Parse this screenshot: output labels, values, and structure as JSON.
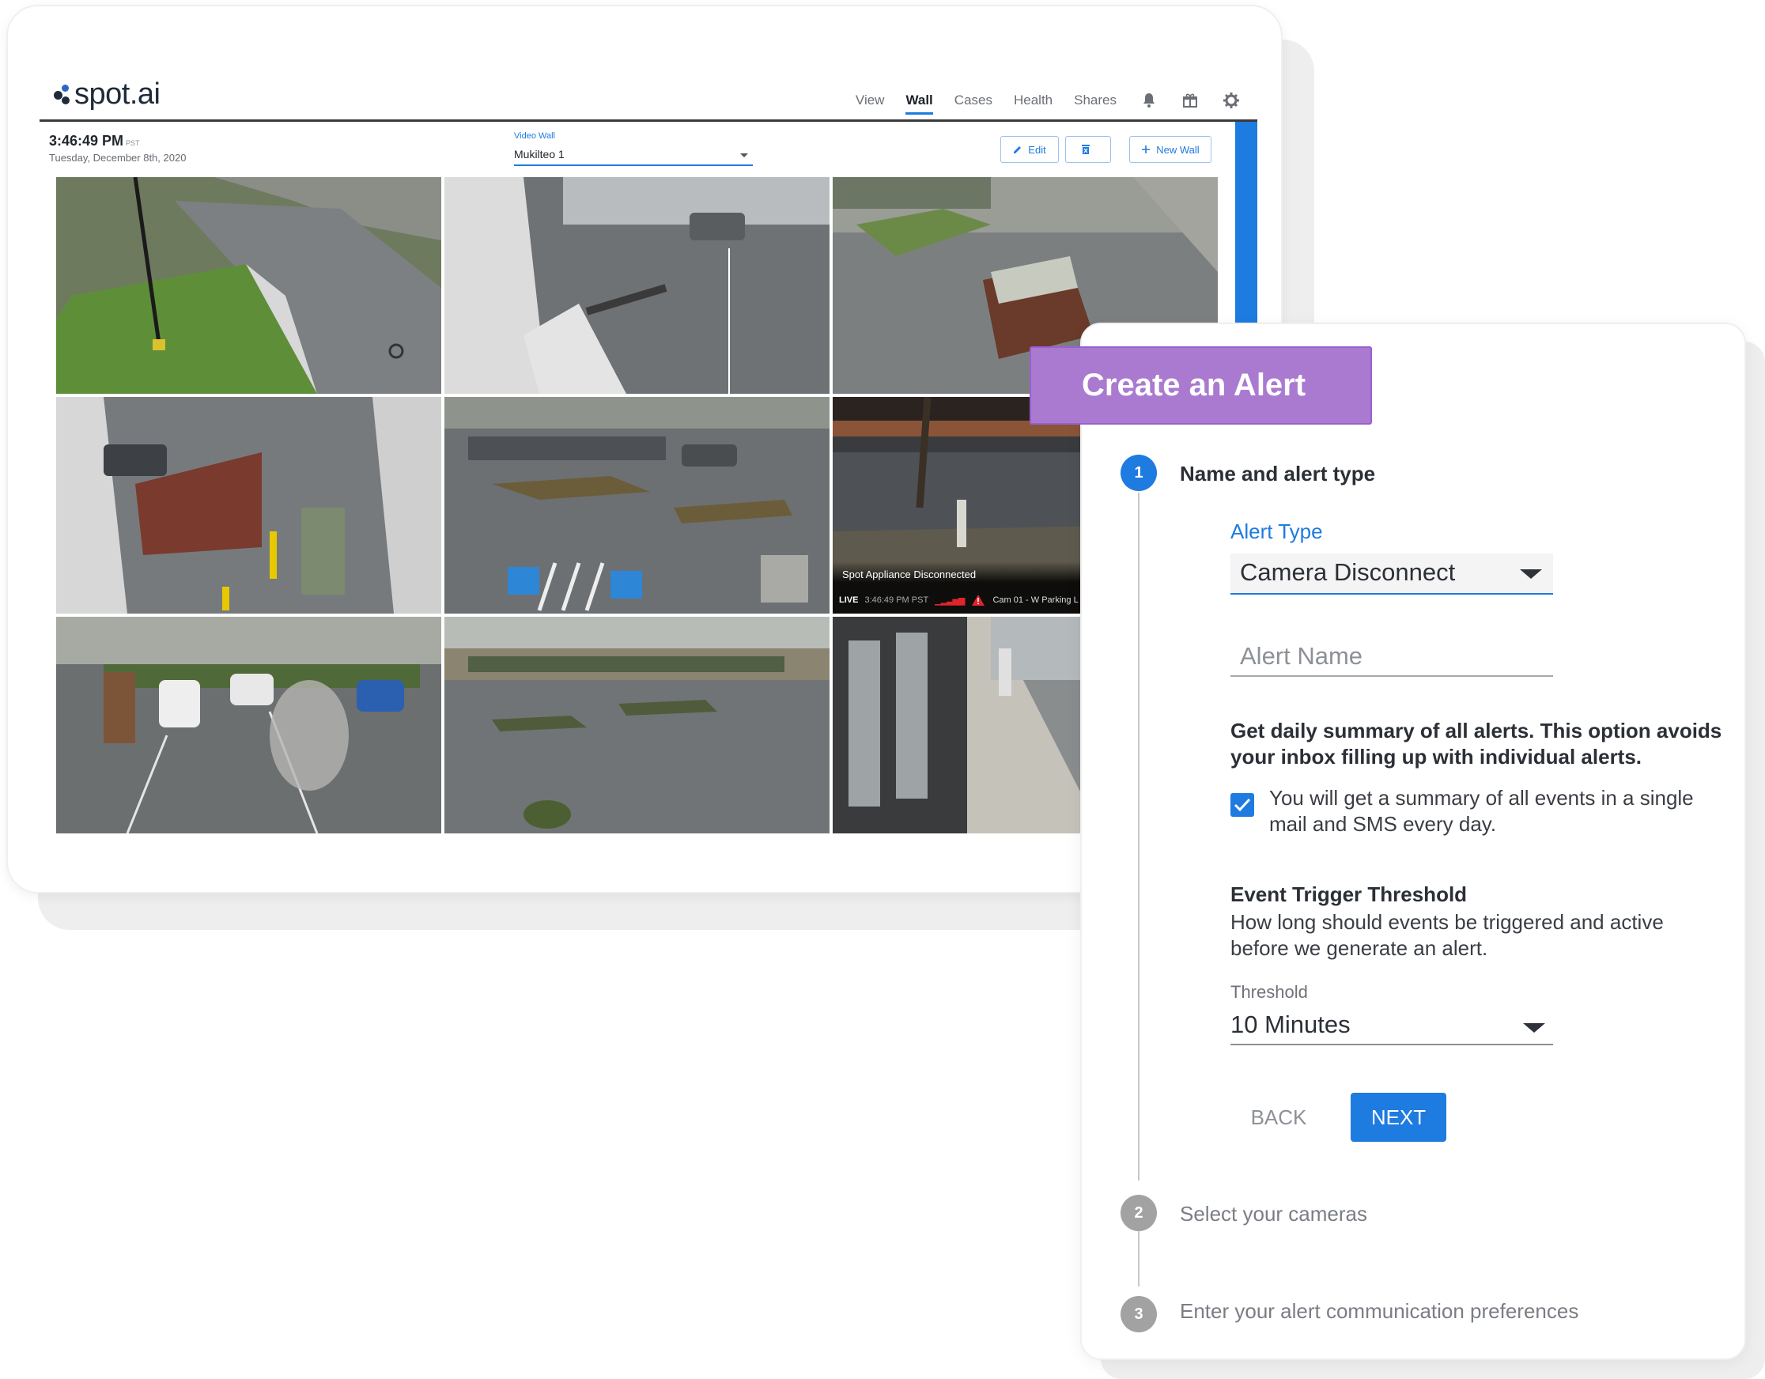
{
  "app": {
    "brand": "spot.ai",
    "nav": [
      "View",
      "Wall",
      "Cases",
      "Health",
      "Shares"
    ],
    "active_nav": "Wall",
    "time": "3:46:49 PM",
    "timezone": "PST",
    "date": "Tuesday, December 8th, 2020",
    "video_wall_label": "Video Wall",
    "video_wall_value": "Mukilteo 1",
    "edit_label": "Edit",
    "new_wall_label": "New Wall",
    "accent": "#1e7be0"
  },
  "camera_overlay": {
    "status": "Spot Appliance Disconnected",
    "live": "LIVE",
    "time": "3:46:49 PM PST",
    "camera": "Cam 01 - W Parking L"
  },
  "alert": {
    "title": "Create an Alert",
    "title_color": "#a97ad0",
    "steps": [
      {
        "num": "1",
        "label": "Name and alert type"
      },
      {
        "num": "2",
        "label": "Select your cameras"
      },
      {
        "num": "3",
        "label": "Enter your alert communication preferences"
      }
    ],
    "alert_type_label": "Alert Type",
    "alert_type_value": "Camera Disconnect",
    "alert_name_placeholder": "Alert Name",
    "summary_heading": "Get daily summary of all alerts. This option avoids your inbox filling up with individual alerts.",
    "summary_checked": true,
    "summary_text": "You will get a summary of all events in a single mail and SMS every day.",
    "threshold_heading": "Event Trigger Threshold",
    "threshold_desc": "How long should events be triggered and active before we generate an alert.",
    "threshold_label": "Threshold",
    "threshold_value": "10 Minutes",
    "back_label": "BACK",
    "next_label": "NEXT"
  }
}
